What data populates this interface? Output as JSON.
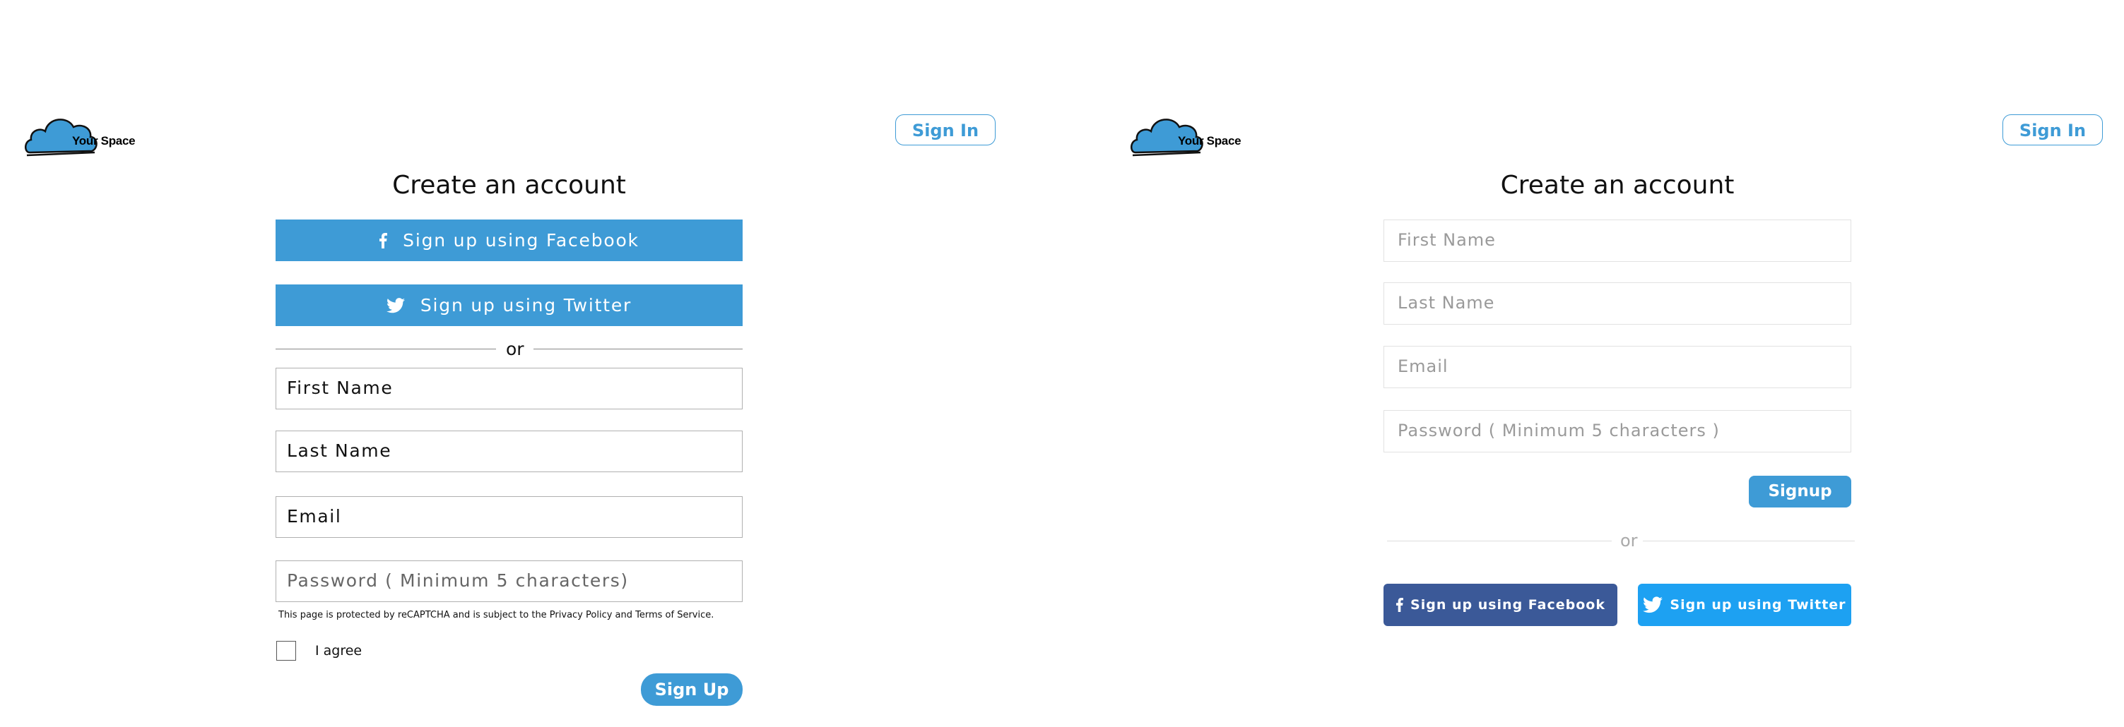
{
  "brand": {
    "name": "Your Space",
    "color": "#3e9bd6"
  },
  "header": {
    "signin_label": "Sign In"
  },
  "left": {
    "title": "Create an account",
    "facebook_label": "Sign up using Facebook",
    "twitter_label": "Sign up using Twitter",
    "or_label": "or",
    "fields": {
      "first_name": "First Name",
      "last_name": "Last Name",
      "email": "Email",
      "password_placeholder": "Password ( Minimum 5 characters)"
    },
    "notice": "This page is protected by reCAPTCHA and is subject to the Privacy Policy and Terms of Service.",
    "agree_label": "I agree",
    "signup_label": "Sign Up"
  },
  "right": {
    "title": "Create an account",
    "fields": {
      "first_name_placeholder": "First Name",
      "last_name_placeholder": "Last Name",
      "email_placeholder": "Email",
      "password_placeholder": "Password ( Minimum 5 characters )"
    },
    "signup_label": "Signup",
    "or_label": "or",
    "facebook_label": "Sign up using Facebook",
    "twitter_label": "Sign up using Twitter",
    "colors": {
      "facebook": "#3b5998",
      "twitter": "#1da1f2"
    }
  },
  "icons": [
    "cloud-logo-icon",
    "facebook-icon",
    "twitter-icon"
  ]
}
